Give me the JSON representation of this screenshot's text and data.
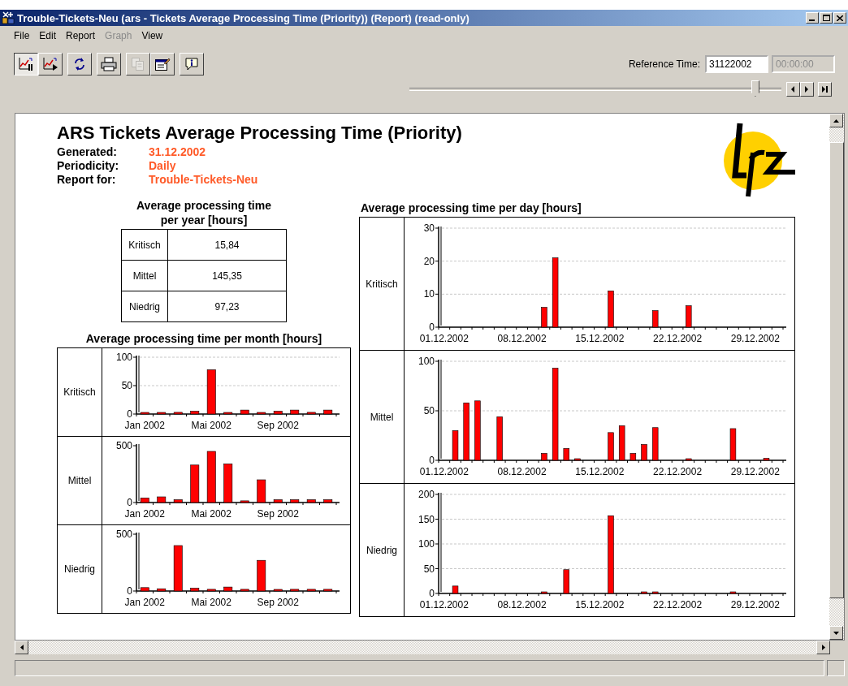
{
  "window": {
    "title": "Trouble-Tickets-Neu (ars - Tickets Average Processing Time (Priority)) (Report) (read-only)"
  },
  "menu": [
    {
      "label": "File",
      "disabled": false
    },
    {
      "label": "Edit",
      "disabled": false
    },
    {
      "label": "Report",
      "disabled": false
    },
    {
      "label": "Graph",
      "disabled": true
    },
    {
      "label": "View",
      "disabled": false
    }
  ],
  "toolbar": [
    {
      "buttons": [
        {
          "kind": "chart-pause",
          "selected": true,
          "disabled": false
        },
        {
          "kind": "chart-play",
          "selected": false,
          "disabled": false
        }
      ]
    },
    {
      "buttons": [
        {
          "kind": "refresh",
          "selected": false,
          "disabled": false
        }
      ]
    },
    {
      "buttons": [
        {
          "kind": "print",
          "selected": false,
          "disabled": false
        }
      ]
    },
    {
      "buttons": [
        {
          "kind": "copy",
          "selected": false,
          "disabled": true
        },
        {
          "kind": "properties",
          "selected": false,
          "disabled": false
        }
      ]
    },
    {
      "buttons": [
        {
          "kind": "info",
          "selected": false,
          "disabled": false
        }
      ]
    }
  ],
  "reference_time": {
    "label": "Reference Time:",
    "date": "31122002",
    "time": "00:00:00",
    "time_disabled": true
  },
  "slider": {
    "level": 0.93
  },
  "report": {
    "title": "ARS Tickets Average Processing Time (Priority)",
    "meta": [
      {
        "label": "Generated:",
        "value": "31.12.2002"
      },
      {
        "label": "Periodicity:",
        "value": "Daily"
      },
      {
        "label": "Report for:",
        "value": "Trouble-Tickets-Neu"
      }
    ],
    "year_table": {
      "title": "Average processing time per year [hours]",
      "rows": [
        {
          "priority": "Kritisch",
          "value": "15,84"
        },
        {
          "priority": "Mittel",
          "value": "145,35"
        },
        {
          "priority": "Niedrig",
          "value": "97,23"
        }
      ]
    },
    "month_table": {
      "title": "Average processing time per month [hours]",
      "rows": [
        {
          "priority": "Kritisch",
          "chart_data": {
            "type": "bar",
            "grid": true,
            "categories": [
              "Jan 2002",
              null,
              null,
              null,
              "Mai 2002",
              null,
              null,
              null,
              "Sep 2002",
              null,
              null,
              null
            ],
            "ylim": [
              0,
              100
            ],
            "yticks": [
              0,
              50,
              100
            ],
            "series": [
              {
                "color": "#ff0000",
                "values": [
                  1,
                  1,
                  3,
                  5,
                  78,
                  1,
                  7,
                  1,
                  5,
                  7,
                  3,
                  7
                ]
              }
            ]
          }
        },
        {
          "priority": "Mittel",
          "chart_data": {
            "type": "bar",
            "grid": false,
            "categories": [
              "Jan 2002",
              null,
              null,
              null,
              "Mai 2002",
              null,
              null,
              null,
              "Sep 2002",
              null,
              null,
              null
            ],
            "ylim": [
              0,
              500
            ],
            "yticks": [
              0,
              500
            ],
            "series": [
              {
                "color": "#ff0000",
                "values": [
                  40,
                  50,
                  25,
                  330,
                  450,
                  340,
                  15,
                  200,
                  25,
                  25,
                  25,
                  25
                ]
              }
            ]
          }
        },
        {
          "priority": "Niedrig",
          "chart_data": {
            "type": "bar",
            "grid": false,
            "categories": [
              "Jan 2002",
              null,
              null,
              null,
              "Mai 2002",
              null,
              null,
              null,
              "Sep 2002",
              null,
              null,
              null
            ],
            "ylim": [
              0,
              500
            ],
            "yticks": [
              0,
              500
            ],
            "series": [
              {
                "color": "#ff0000",
                "values": [
                  30,
                  20,
                  400,
                  25,
                  15,
                  35,
                  15,
                  270,
                  5,
                  15,
                  15,
                  15
                ]
              }
            ]
          }
        }
      ]
    },
    "day_table": {
      "title": "Average processing time per day [hours]",
      "rows": [
        {
          "priority": "Kritisch",
          "chart_data": {
            "type": "bar",
            "grid": true,
            "categories": [
              "01.12.2002",
              null,
              null,
              null,
              null,
              null,
              null,
              "08.12.2002",
              null,
              null,
              null,
              null,
              null,
              null,
              "15.12.2002",
              null,
              null,
              null,
              null,
              null,
              null,
              "22.12.2002",
              null,
              null,
              null,
              null,
              null,
              null,
              "29.12.2002",
              null,
              null
            ],
            "ylim": [
              0,
              30
            ],
            "yticks": [
              0,
              10,
              20,
              30
            ],
            "series": [
              {
                "color": "#ff0000",
                "values": [
                  null,
                  null,
                  null,
                  null,
                  null,
                  null,
                  null,
                  null,
                  null,
                  6,
                  21,
                  null,
                  null,
                  null,
                  null,
                  11,
                  null,
                  null,
                  null,
                  5,
                  null,
                  null,
                  6.5,
                  null,
                  null,
                  null,
                  null,
                  null,
                  null,
                  null,
                  null
                ]
              }
            ]
          }
        },
        {
          "priority": "Mittel",
          "chart_data": {
            "type": "bar",
            "grid": true,
            "categories": [
              "01.12.2002",
              null,
              null,
              null,
              null,
              null,
              null,
              "08.12.2002",
              null,
              null,
              null,
              null,
              null,
              null,
              "15.12.2002",
              null,
              null,
              null,
              null,
              null,
              null,
              "22.12.2002",
              null,
              null,
              null,
              null,
              null,
              null,
              "29.12.2002",
              null,
              null
            ],
            "ylim": [
              0,
              100
            ],
            "yticks": [
              0,
              50,
              100
            ],
            "series": [
              {
                "color": "#ff0000",
                "values": [
                  null,
                  30,
                  58,
                  60,
                  null,
                  44,
                  null,
                  null,
                  null,
                  7,
                  93,
                  12,
                  1,
                  null,
                  null,
                  28,
                  35,
                  7,
                  16,
                  33,
                  null,
                  null,
                  1,
                  null,
                  null,
                  null,
                  32,
                  null,
                  null,
                  2,
                  null
                ]
              }
            ]
          }
        },
        {
          "priority": "Niedrig",
          "chart_data": {
            "type": "bar",
            "grid": true,
            "categories": [
              "01.12.2002",
              null,
              null,
              null,
              null,
              null,
              null,
              "08.12.2002",
              null,
              null,
              null,
              null,
              null,
              null,
              "15.12.2002",
              null,
              null,
              null,
              null,
              null,
              null,
              "22.12.2002",
              null,
              null,
              null,
              null,
              null,
              null,
              "29.12.2002",
              null,
              null
            ],
            "ylim": [
              0,
              200
            ],
            "yticks": [
              0,
              50,
              100,
              150,
              200
            ],
            "series": [
              {
                "color": "#ff0000",
                "values": [
                  null,
                  15,
                  null,
                  null,
                  null,
                  null,
                  null,
                  null,
                  null,
                  2,
                  null,
                  48,
                  null,
                  null,
                  null,
                  157,
                  null,
                  null,
                  2,
                  1,
                  null,
                  null,
                  null,
                  null,
                  null,
                  null,
                  1,
                  null,
                  null,
                  null,
                  null
                ]
              }
            ]
          }
        }
      ]
    }
  }
}
